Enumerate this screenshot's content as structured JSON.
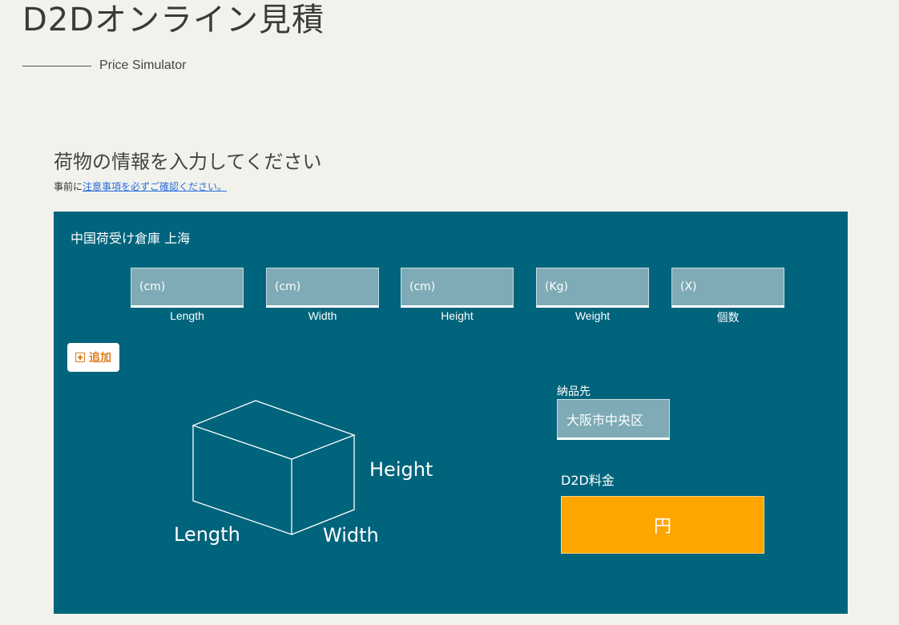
{
  "header": {
    "title": "D2Dオンライン見積",
    "subtitle": "Price Simulator"
  },
  "section": {
    "heading": "荷物の情報を入力してください",
    "notice_prefix": "事前に",
    "notice_link": "注意事項を必ずご確認ください。"
  },
  "panel": {
    "warehouse": "中国荷受け倉庫 上海",
    "fields": [
      {
        "placeholder": "(cm)",
        "label": "Length"
      },
      {
        "placeholder": "(cm)",
        "label": "Width"
      },
      {
        "placeholder": "(cm)",
        "label": "Height"
      },
      {
        "placeholder": "(Kg)",
        "label": "Weight"
      },
      {
        "placeholder": "(X)",
        "label": "個数"
      }
    ],
    "add_button": "追加",
    "diagram": {
      "height_label": "Height",
      "length_label": "Length",
      "width_label": "Width"
    },
    "destination_label": "納品先",
    "destination_value": "大阪市中央区",
    "price_label": "D2D料金",
    "price_value": "円"
  },
  "colors": {
    "background": "#f2f2ed",
    "panel": "#00647c",
    "input": "#7eabb5",
    "accent_orange": "#ffa500",
    "link_blue": "#2a6fdb"
  }
}
